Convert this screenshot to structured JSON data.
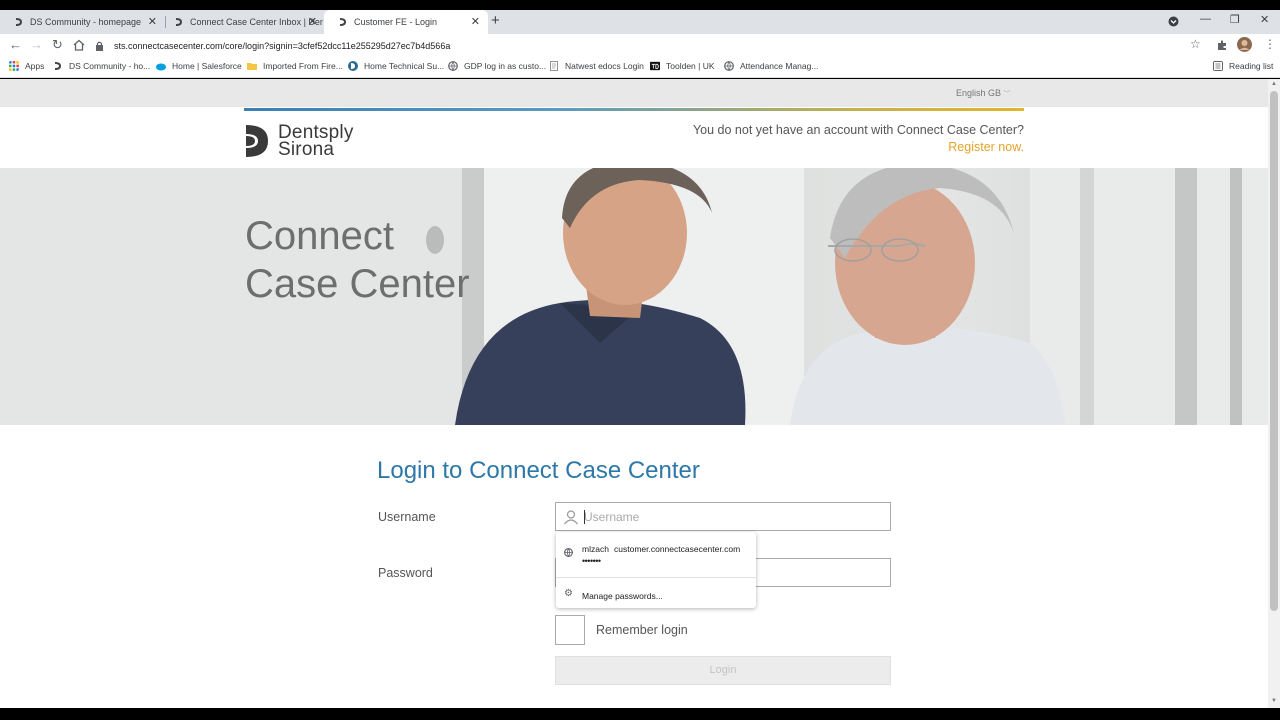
{
  "browser": {
    "tabs": [
      {
        "title": "DS Community - homepage"
      },
      {
        "title": "Connect Case Center Inbox | Der"
      },
      {
        "title": "Customer FE - Login"
      }
    ],
    "url": "sts.connectcasecenter.com/core/login?signin=3cfef52dcc11e255295d27ec7b4d566a",
    "bookmarks": [
      "Apps",
      "DS Community - ho...",
      "Home | Salesforce",
      "Imported From Fire...",
      "Home Technical Su...",
      "GDP log in as custo...",
      "Natwest edocs Login",
      "Toolden | UK",
      "Attendance Manag..."
    ],
    "reading_list": "Reading list"
  },
  "page": {
    "language": "English GB",
    "logo": {
      "line1": "Dentsply",
      "line2": "Sirona"
    },
    "no_account": "You do not yet have an account with Connect Case Center?",
    "register": "Register now.",
    "hero": {
      "line1": "Connect",
      "line2": "Case Center"
    },
    "login_title": "Login to Connect Case Center",
    "username_label": "Username",
    "username_placeholder": "Username",
    "password_label": "Password",
    "remember_label": "Remember login",
    "login_button": "Login",
    "autofill": {
      "user": "mlzach",
      "site": "customer.connectcasecenter.com",
      "masked": "•••••••",
      "manage": "Manage passwords..."
    }
  },
  "colors": {
    "title_blue": "#2d78a8",
    "register_orange": "#e5a52b"
  }
}
